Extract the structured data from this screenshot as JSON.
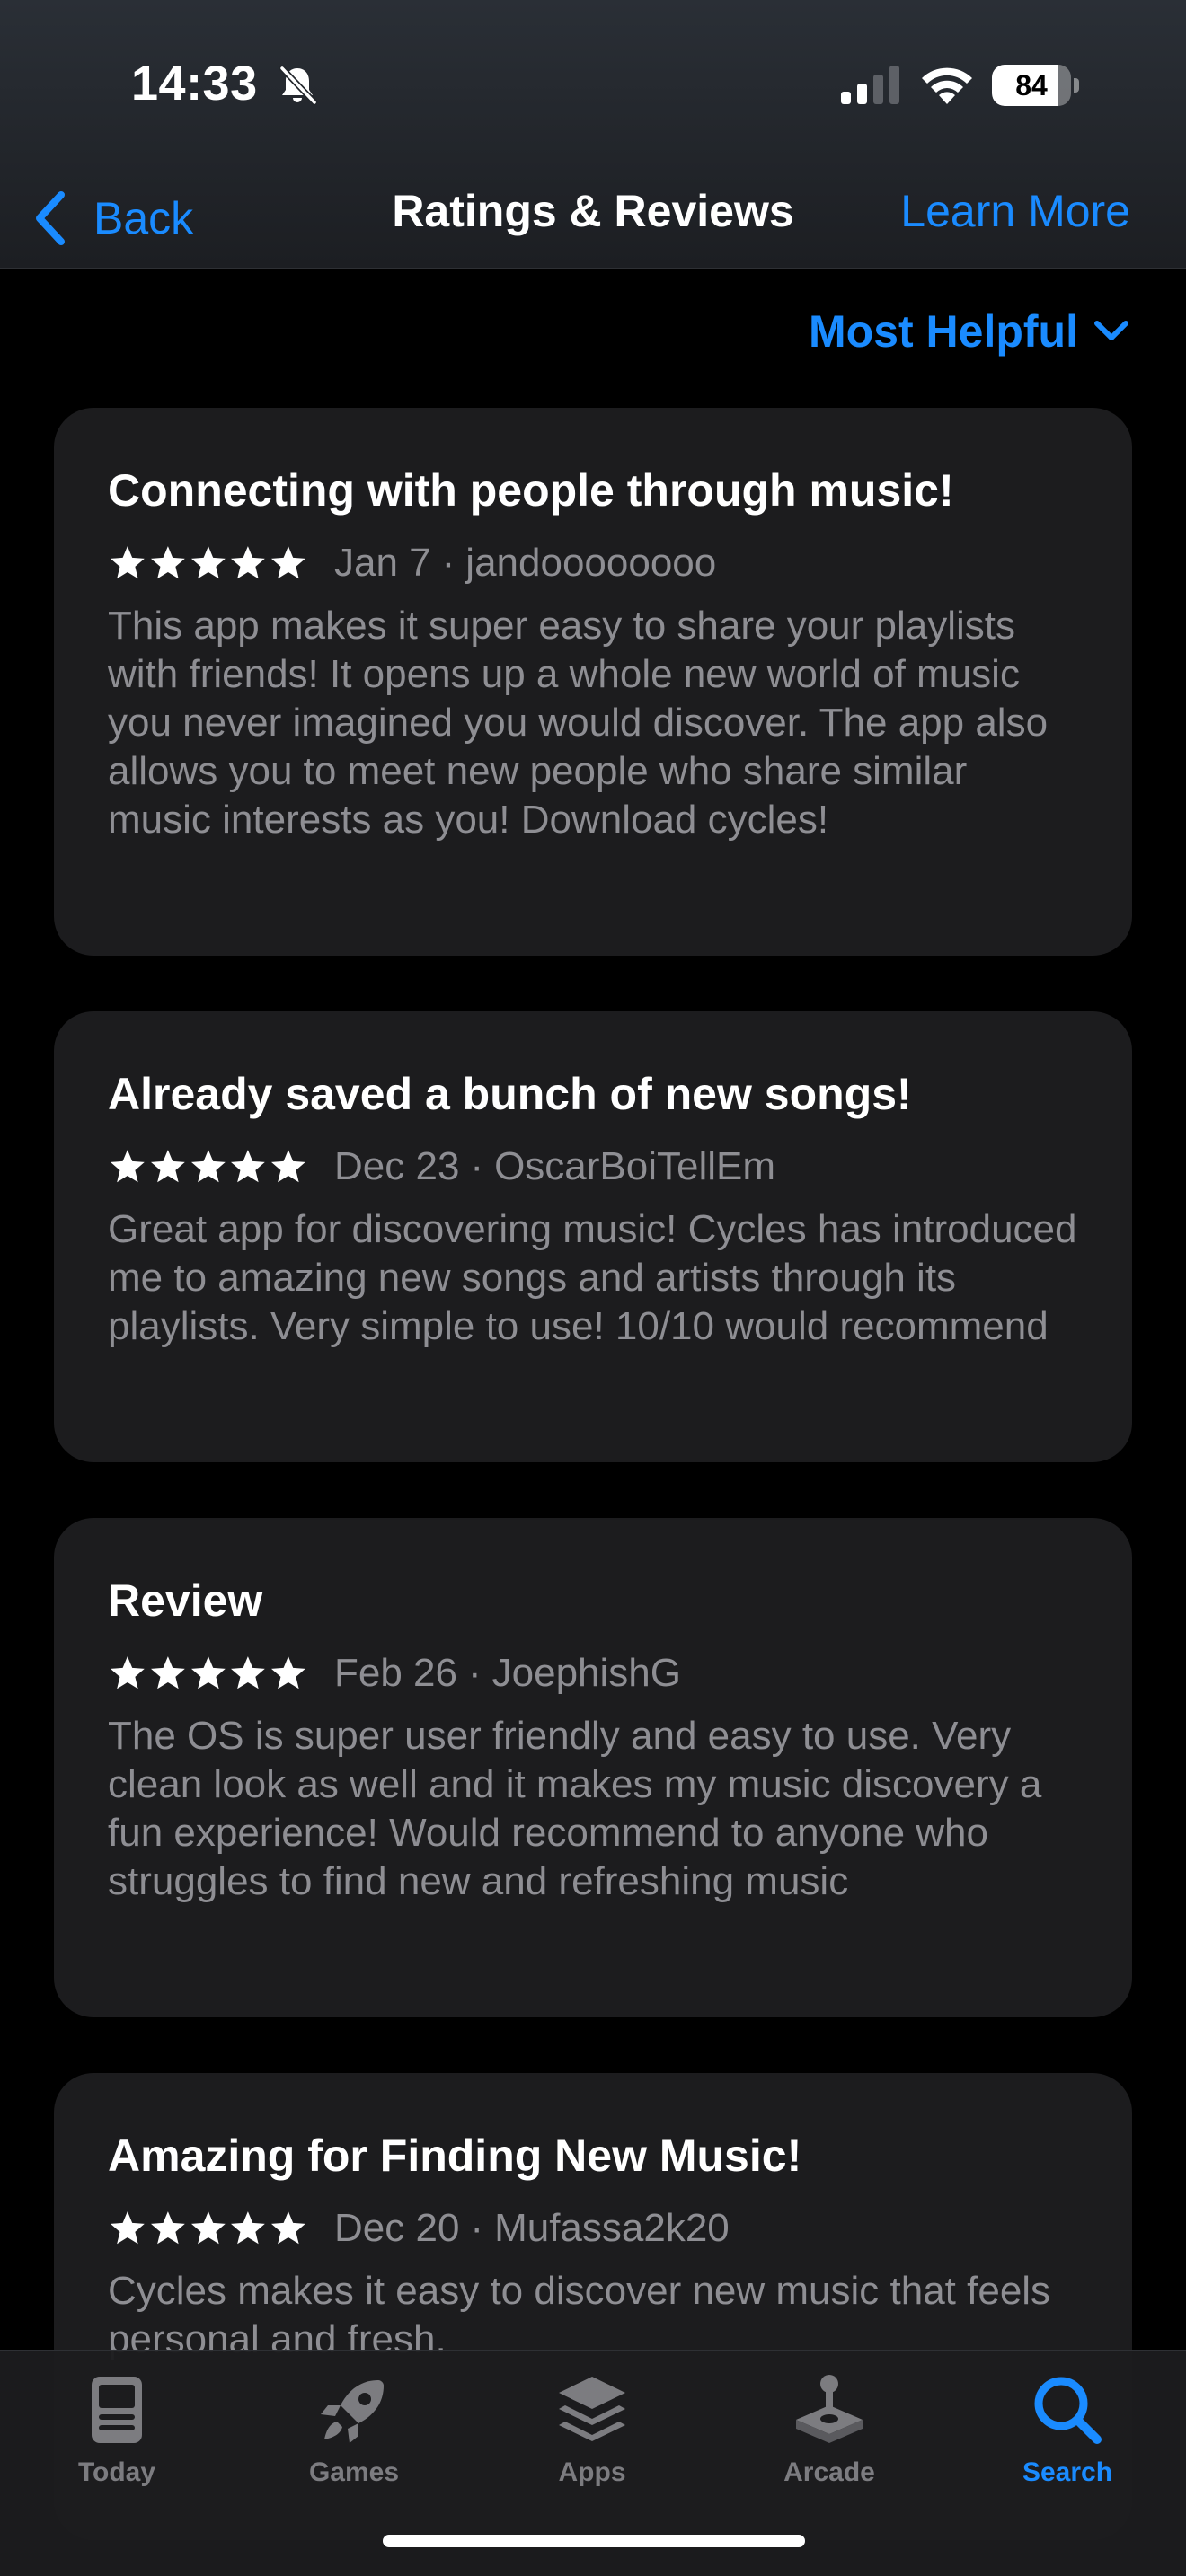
{
  "status_bar": {
    "time": "14:33",
    "battery_level": "84",
    "battery_fraction": 0.84,
    "icons": [
      "bell-slash-icon",
      "cellular-signal-icon",
      "wifi-icon",
      "battery-icon"
    ]
  },
  "nav": {
    "back_label": "Back",
    "title": "Ratings & Reviews",
    "learn_more_label": "Learn More"
  },
  "sort": {
    "label": "Most Helpful"
  },
  "reviews": [
    {
      "title": "Connecting with people through music!",
      "rating": 5,
      "date": "Jan 7",
      "author": "jandoooooooo",
      "body": "This app makes it super easy to share your playlists with friends! It opens up a whole new world of music you never imagined you would discover. The app also allows you to meet new people who share similar music interests as you! Download cycles!"
    },
    {
      "title": "Already saved a bunch of new songs!",
      "rating": 5,
      "date": "Dec 23",
      "author": "OscarBoiTellEm",
      "body": "Great app for discovering music! Cycles has introduced me to amazing new songs and artists through its playlists. Very simple to use! 10/10 would recommend"
    },
    {
      "title": "Review",
      "rating": 5,
      "date": "Feb 26",
      "author": "JoephishG",
      "body": "The OS is super user friendly and easy to use. Very clean look as well and it makes my music discovery a fun experience! Would recommend to anyone who struggles to find new and refreshing music"
    },
    {
      "title": "Amazing for Finding New Music!",
      "rating": 5,
      "date": "Dec 20",
      "author": "Mufassa2k20",
      "body": "Cycles makes it easy to discover new music that feels personal and fresh."
    }
  ],
  "tabbar": {
    "tabs": [
      {
        "label": "Today",
        "icon": "today-icon",
        "active": false
      },
      {
        "label": "Games",
        "icon": "rocket-icon",
        "active": false
      },
      {
        "label": "Apps",
        "icon": "apps-stack-icon",
        "active": false
      },
      {
        "label": "Arcade",
        "icon": "joystick-icon",
        "active": false
      },
      {
        "label": "Search",
        "icon": "search-icon",
        "active": true
      }
    ]
  },
  "colors": {
    "accent": "#1a8bff",
    "background": "#000000",
    "card": "#1c1c1e",
    "secondary_text": "#8e8e93"
  }
}
